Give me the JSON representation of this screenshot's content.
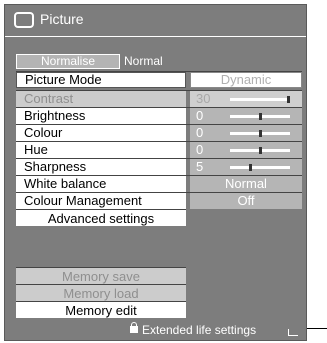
{
  "title": "Picture",
  "normalise": {
    "button_label": "Normalise",
    "value": "Normal"
  },
  "rows": [
    {
      "label": "Picture Mode",
      "value": "Dynamic"
    },
    {
      "label": "Contrast",
      "value": "30",
      "level": 0.96
    },
    {
      "label": "Brightness",
      "value": "0",
      "level": 0.5
    },
    {
      "label": "Colour",
      "value": "0",
      "level": 0.5
    },
    {
      "label": "Hue",
      "value": "0",
      "level": 0.5
    },
    {
      "label": "Sharpness",
      "value": "5",
      "level": 0.33
    },
    {
      "label": "White balance",
      "value": "Normal"
    },
    {
      "label": "Colour Management",
      "value": "Off"
    }
  ],
  "buttons": {
    "advanced": "Advanced settings",
    "memory_save": "Memory save",
    "memory_load": "Memory load",
    "memory_edit": "Memory edit"
  },
  "footer": {
    "label": "Extended life settings"
  },
  "icons": {
    "title": "picture-icon",
    "footer_lock": "lock-icon",
    "footer_arrow": "return-arrow-icon"
  },
  "colors": {
    "panel_bg": "#7d7d7d",
    "row_bg": "#ffffff",
    "value_bg": "#b5b5b5"
  }
}
